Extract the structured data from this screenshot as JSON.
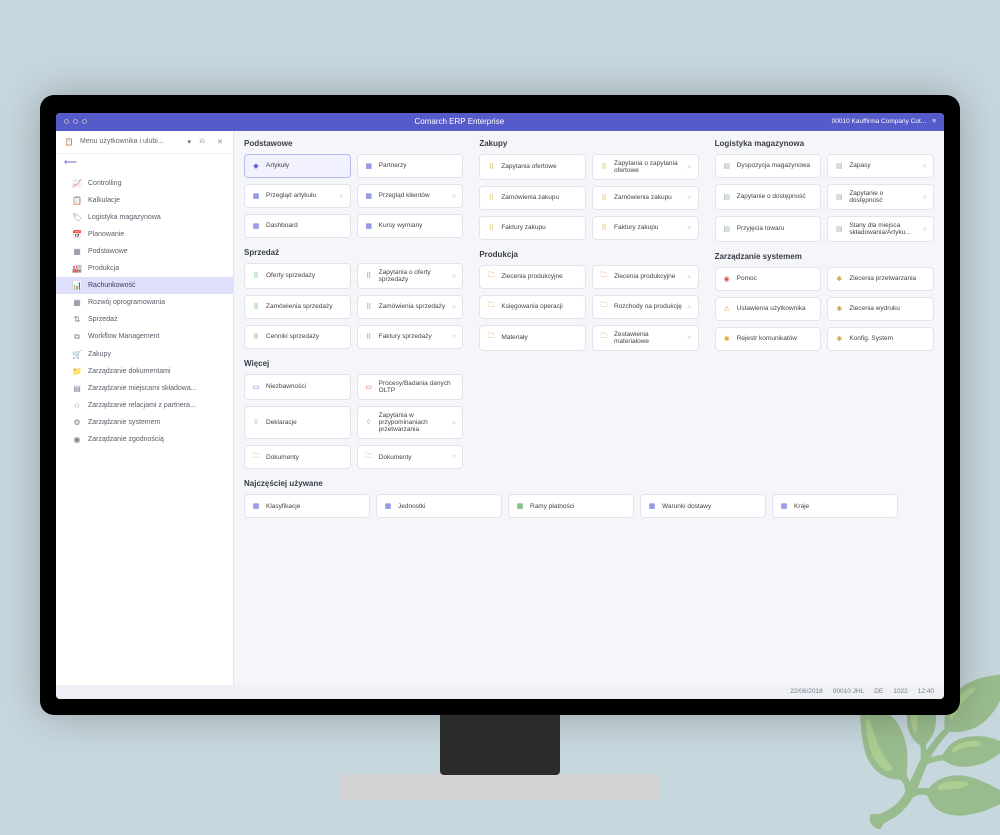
{
  "titlebar": {
    "title": "Comarch ERP Enterprise",
    "user": "00010  Kauffirma Company Cot..."
  },
  "sidebar_top": {
    "combo": "Menu użytkownika i ulubi..."
  },
  "nav": [
    {
      "icon": "📈",
      "label": "Controlling"
    },
    {
      "icon": "📋",
      "label": "Kalkulacje"
    },
    {
      "icon": "🏷",
      "label": "Logistyka magazynowa"
    },
    {
      "icon": "📅",
      "label": "Planowanie"
    },
    {
      "icon": "▦",
      "label": "Podstawowe"
    },
    {
      "icon": "🏭",
      "label": "Produkcja"
    },
    {
      "icon": "📊",
      "label": "Rachunkowość",
      "active": true
    },
    {
      "icon": "▦",
      "label": "Rozwój oprogramowania"
    },
    {
      "icon": "⇅",
      "label": "Sprzedaż"
    },
    {
      "icon": "⧉",
      "label": "Workflow Management"
    },
    {
      "icon": "🛒",
      "label": "Zakupy"
    },
    {
      "icon": "📁",
      "label": "Zarządzanie dokumentami"
    },
    {
      "icon": "▤",
      "label": "Zarządzanie miejscami składowa..."
    },
    {
      "icon": "☆",
      "label": "Zarządzanie relacjami z partnera..."
    },
    {
      "icon": "⚙",
      "label": "Zarządzanie systemem"
    },
    {
      "icon": "◉",
      "label": "Zarządzanie zgodnością"
    }
  ],
  "col1": [
    {
      "title": "Podstawowe",
      "tiles": [
        {
          "ico": "◆",
          "c": "ico-blue",
          "label": "Artykuły",
          "sel": true
        },
        {
          "ico": "▦",
          "c": "ico-blue",
          "label": "Partnerzy"
        },
        {
          "ico": "▦",
          "c": "ico-blue",
          "label": "Przegląd artykułu",
          "srch": true
        },
        {
          "ico": "▦",
          "c": "ico-blue",
          "label": "Przegląd klientów",
          "srch": true
        },
        {
          "ico": "▦",
          "c": "ico-blue",
          "label": "Dashboard"
        },
        {
          "ico": "▦",
          "c": "ico-blue",
          "label": "Kursy wymiany"
        }
      ]
    },
    {
      "title": "Sprzedaż",
      "tiles": [
        {
          "ico": "⠿",
          "c": "ico-green",
          "label": "Oferty sprzedaży"
        },
        {
          "ico": "⠿",
          "c": "ico-green",
          "label": "Zapytania o oferty sprzedaży",
          "srch": true
        },
        {
          "ico": "⠿",
          "c": "ico-green",
          "label": "Zamówienia sprzedaży"
        },
        {
          "ico": "⠿",
          "c": "ico-green",
          "label": "Zamówienia sprzedaży",
          "srch": true
        },
        {
          "ico": "⠿",
          "c": "ico-green",
          "label": "Cenniki sprzedaży"
        },
        {
          "ico": "⠿",
          "c": "ico-green",
          "label": "Faktury sprzedaży",
          "srch": true
        }
      ]
    },
    {
      "title": "Więcej",
      "tiles": [
        {
          "ico": "▭",
          "c": "ico-blue",
          "label": "Niezbawności"
        },
        {
          "ico": "▭",
          "c": "ico-red",
          "label": "Procesy/Badania danych OLTP"
        },
        {
          "ico": "◊",
          "c": "ico-grey",
          "label": "Deklaracje"
        },
        {
          "ico": "◊",
          "c": "ico-grey",
          "label": "Zapytania w przypominaniach przetwarzania",
          "srch": true
        },
        {
          "ico": "🗀",
          "c": "ico-folder",
          "label": "Dokumenty"
        },
        {
          "ico": "🗀",
          "c": "ico-folder",
          "label": "Dokumenty",
          "srch": true
        }
      ]
    }
  ],
  "col2": [
    {
      "title": "Zakupy",
      "tiles": [
        {
          "ico": "⠿",
          "c": "ico-yellow",
          "label": "Zapytania ofertowe"
        },
        {
          "ico": "⠿",
          "c": "ico-yellow",
          "label": "Zapytania o zapytania ofertowe",
          "srch": true
        },
        {
          "ico": "⠿",
          "c": "ico-yellow",
          "label": "Zamówienia zakupu"
        },
        {
          "ico": "⠿",
          "c": "ico-yellow",
          "label": "Zamówienia zakupu",
          "srch": true
        },
        {
          "ico": "⠿",
          "c": "ico-yellow",
          "label": "Faktury zakupu"
        },
        {
          "ico": "⠿",
          "c": "ico-yellow",
          "label": "Faktury zakupu",
          "srch": true
        }
      ]
    },
    {
      "title": "Produkcja",
      "tiles": [
        {
          "ico": "🗀",
          "c": "ico-folder",
          "label": "Zlecenia produkcyjne"
        },
        {
          "ico": "🗀",
          "c": "ico-folder",
          "label": "Zlecenia produkcyjne",
          "srch": true
        },
        {
          "ico": "🗀",
          "c": "ico-folder",
          "label": "Księgowania operacji"
        },
        {
          "ico": "🗀",
          "c": "ico-folder",
          "label": "Rozchody na produkcję",
          "srch": true
        },
        {
          "ico": "🗀",
          "c": "ico-folder",
          "label": "Materiały"
        },
        {
          "ico": "🗀",
          "c": "ico-folder",
          "label": "Zestawienia materiałowe",
          "srch": true
        }
      ]
    }
  ],
  "col3": [
    {
      "title": "Logistyka magazynowa",
      "tiles": [
        {
          "ico": "▤",
          "c": "ico-grey",
          "label": "Dyspozycja magazynowa"
        },
        {
          "ico": "▤",
          "c": "ico-grey",
          "label": "Zapasy",
          "srch": true
        },
        {
          "ico": "▤",
          "c": "ico-grey",
          "label": "Zapytanie o dostępność"
        },
        {
          "ico": "▤",
          "c": "ico-grey",
          "label": "Zapytanie o dostępność",
          "srch": true
        },
        {
          "ico": "▤",
          "c": "ico-grey",
          "label": "Przyjęcia towaru"
        },
        {
          "ico": "▤",
          "c": "ico-grey",
          "label": "Stany dla miejsca składowania/Artyku...",
          "srch": true
        }
      ]
    },
    {
      "title": "Zarządzanie systemem",
      "tiles": [
        {
          "ico": "◉",
          "c": "ico-red",
          "label": "Pomoc"
        },
        {
          "ico": "✱",
          "c": "ico-amber",
          "label": "Zlecenia przetwarzania"
        },
        {
          "ico": "⚠",
          "c": "ico-amber",
          "label": "Ustawienia użytkownika"
        },
        {
          "ico": "✱",
          "c": "ico-amber",
          "label": "Zlecenia wydruku"
        },
        {
          "ico": "✱",
          "c": "ico-amber",
          "label": "Rejestr komunikatów"
        },
        {
          "ico": "✱",
          "c": "ico-amber",
          "label": "Konfig. System"
        }
      ]
    }
  ],
  "bottom": {
    "title": "Najczęściej używane",
    "tiles": [
      {
        "ico": "▦",
        "c": "ico-blue",
        "label": "Klasyfikacje"
      },
      {
        "ico": "▦",
        "c": "ico-blue",
        "label": "Jednostki"
      },
      {
        "ico": "▦",
        "c": "ico-green",
        "label": "Ramy płatności"
      },
      {
        "ico": "▦",
        "c": "ico-blue",
        "label": "Warunki dostawy"
      },
      {
        "ico": "▦",
        "c": "ico-blue",
        "label": "Kraje"
      }
    ]
  },
  "status": {
    "date": "22/06/2018",
    "code": "00010 JHL",
    "lang": "DE",
    "ver": "1022",
    "time": "12:40"
  }
}
